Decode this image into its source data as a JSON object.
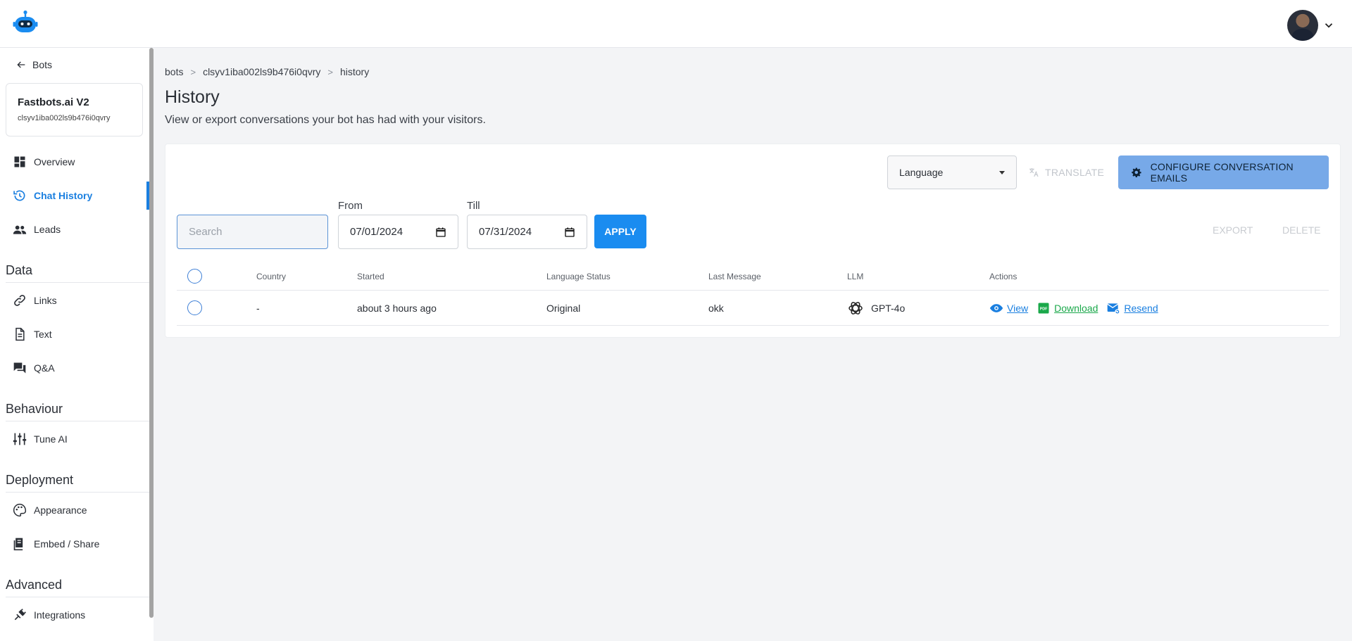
{
  "header": {
    "logo_name": "robot-logo"
  },
  "sidebar": {
    "back_label": "Bots",
    "bot_name": "Fastbots.ai V2",
    "bot_id": "clsyv1iba002ls9b476i0qvry",
    "items": [
      {
        "label": "Overview",
        "icon": "dashboard-icon"
      },
      {
        "label": "Chat History",
        "icon": "history-icon",
        "active": true
      },
      {
        "label": "Leads",
        "icon": "people-icon"
      }
    ],
    "sections": [
      {
        "title": "Data",
        "items": [
          {
            "label": "Links"
          },
          {
            "label": "Text"
          },
          {
            "label": "Q&A"
          }
        ]
      },
      {
        "title": "Behaviour",
        "items": [
          {
            "label": "Tune AI"
          }
        ]
      },
      {
        "title": "Deployment",
        "items": [
          {
            "label": "Appearance"
          },
          {
            "label": "Embed / Share"
          }
        ]
      },
      {
        "title": "Advanced",
        "items": [
          {
            "label": "Integrations"
          }
        ]
      }
    ]
  },
  "main": {
    "breadcrumb": [
      "bots",
      "clsyv1iba002ls9b476i0qvry",
      "history"
    ],
    "title": "History",
    "description": "View or export conversations your bot has had with your visitors.",
    "toolbar": {
      "language_label": "Language",
      "translate_label": "TRANSLATE",
      "configure_label": "CONFIGURE CONVERSATION EMAILS"
    },
    "filters": {
      "search_placeholder": "Search",
      "from_label": "From",
      "from_value": "07/01/2024",
      "till_label": "Till",
      "till_value": "07/31/2024",
      "apply_label": "APPLY",
      "export_label": "EXPORT",
      "delete_label": "DELETE"
    },
    "table": {
      "columns": [
        "Country",
        "Started",
        "Language Status",
        "Last Message",
        "LLM",
        "Actions"
      ],
      "rows": [
        {
          "country": "-",
          "started": "about 3 hours ago",
          "language_status": "Original",
          "last_message": "okk",
          "llm": "GPT-4o",
          "actions": {
            "view": "View",
            "download": "Download",
            "resend": "Resend"
          }
        }
      ]
    }
  },
  "colors": {
    "accent": "#1a8cf0",
    "config_button": "#77a9e8",
    "download": "#1aa84a"
  }
}
